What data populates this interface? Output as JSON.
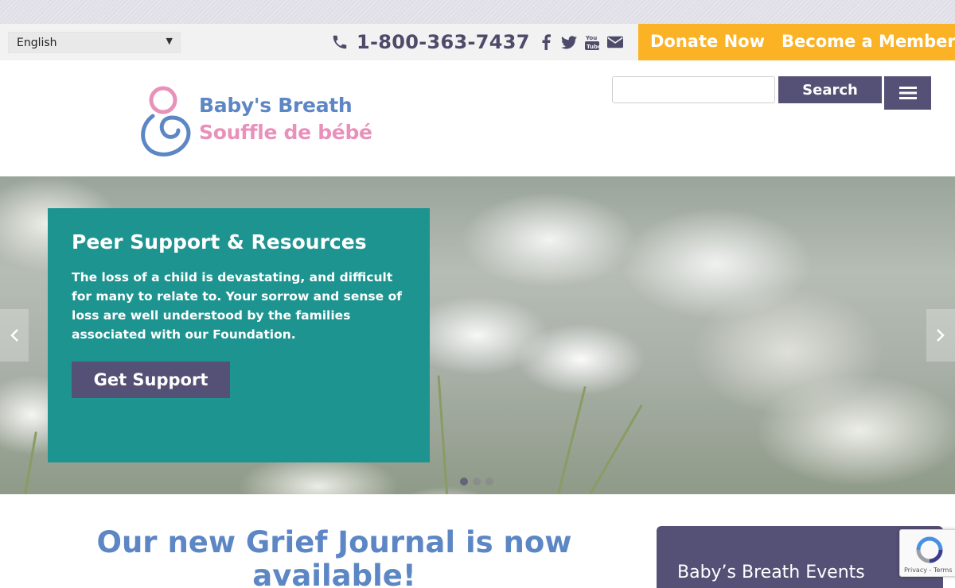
{
  "language_select": {
    "value": "English"
  },
  "phone": {
    "number": "1-800-363-7437"
  },
  "social": {
    "icons": [
      "facebook-icon",
      "twitter-icon",
      "youtube-icon",
      "email-icon"
    ]
  },
  "cta_bar": {
    "donate_label": "Donate Now",
    "member_label": "Become a Member"
  },
  "logo": {
    "name_en": "Baby's Breath",
    "name_fr": "Souffle de bébé"
  },
  "search": {
    "value": "",
    "button_label": "Search"
  },
  "hero": {
    "title": "Peer Support & Resources",
    "body": "The loss of a child is devastating, and difficult for many to relate to. Your sorrow and sense of loss are well understood by the families associated with our Foundation.",
    "button_label": "Get Support",
    "slides_count": 3,
    "active_slide": 1
  },
  "main": {
    "heading": "Our new Grief Journal is now available!"
  },
  "sidebar": {
    "events_title": "Baby’s Breath Events"
  },
  "recaptcha": {
    "links": "Privacy - Terms"
  },
  "colors": {
    "accent_purple": "#555075",
    "teal": "#1e9490",
    "yellow": "#fbb224",
    "brand_blue": "#5c86c4",
    "brand_pink": "#e891bb"
  }
}
